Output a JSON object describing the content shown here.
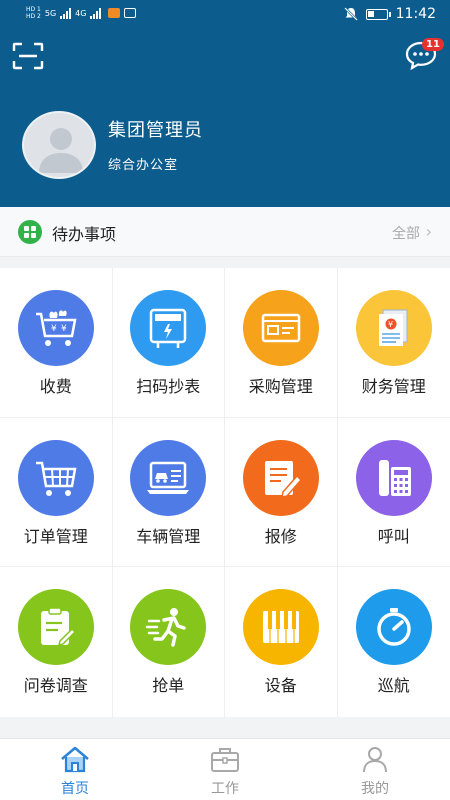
{
  "statusbar": {
    "network1": "5G",
    "network2": "4G",
    "time": "11:42"
  },
  "header": {
    "message_count": "11"
  },
  "user": {
    "name": "集团管理员",
    "department": "综合办公室"
  },
  "todo": {
    "title": "待办事项",
    "all_label": "全部"
  },
  "grid": [
    {
      "label": "收费",
      "icon": "money-cart-icon",
      "color": "#4f7be6"
    },
    {
      "label": "扫码抄表",
      "icon": "meter-icon",
      "color": "#2e9bf0"
    },
    {
      "label": "采购管理",
      "icon": "purchase-icon",
      "color": "#f7a21b"
    },
    {
      "label": "财务管理",
      "icon": "finance-doc-icon",
      "color": "#fbc53a"
    },
    {
      "label": "订单管理",
      "icon": "shopping-cart-icon",
      "color": "#4f7be6"
    },
    {
      "label": "车辆管理",
      "icon": "vehicle-laptop-icon",
      "color": "#4f7be6"
    },
    {
      "label": "报修",
      "icon": "repair-form-icon",
      "color": "#f26b1d"
    },
    {
      "label": "呼叫",
      "icon": "phone-icon",
      "color": "#8b62e8"
    },
    {
      "label": "问卷调查",
      "icon": "survey-icon",
      "color": "#85c51c"
    },
    {
      "label": "抢单",
      "icon": "runner-icon",
      "color": "#85c51c"
    },
    {
      "label": "设备",
      "icon": "piano-keys-icon",
      "color": "#f7b500"
    },
    {
      "label": "巡航",
      "icon": "timer-icon",
      "color": "#1e9bea"
    }
  ],
  "tabs": [
    {
      "label": "首页",
      "icon": "home-icon",
      "active": true
    },
    {
      "label": "工作",
      "icon": "briefcase-icon",
      "active": false
    },
    {
      "label": "我的",
      "icon": "person-icon",
      "active": false
    }
  ]
}
